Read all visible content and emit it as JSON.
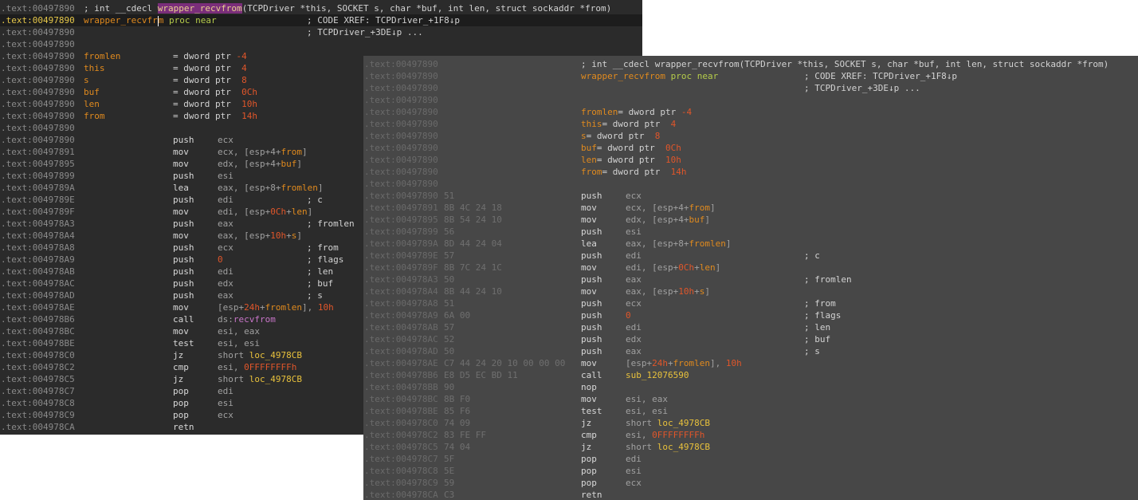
{
  "colors": {
    "left_bg": "#2b2b2b",
    "right_bg": "#474747",
    "comment": "#d3d3d3",
    "highlight_bg": "#7a2e7a",
    "symbol": "#e08a1e",
    "keyword": "#b5cc4a",
    "immediate": "#e0562a",
    "location": "#e8c13c",
    "import": "#c875c8"
  },
  "left_listing": {
    "header_comment_prefix": "; int __cdecl ",
    "header_function_name": "wrapper_recvfrom",
    "header_comment_suffix": "(TCPDriver *this, SOCKET s, char *buf, int len, struct sockaddr *from)",
    "proc_name_before_caret": "wrapper_recvfr",
    "proc_name_after_caret": "m",
    "proc_keyword": "proc near",
    "xref_1": "; CODE XREF: TCPDriver_+1F8↓p",
    "xref_2": "; TCPDriver_+3DE↓p ...",
    "addresses": [
      ".text:00497890",
      ".text:00497890",
      ".text:00497890",
      ".text:00497890",
      ".text:00497890",
      ".text:00497890",
      ".text:00497890",
      ".text:00497890",
      ".text:00497890",
      ".text:00497890",
      ".text:00497890",
      ".text:00497890",
      ".text:00497891",
      ".text:00497895",
      ".text:00497899",
      ".text:0049789A",
      ".text:0049789E",
      ".text:0049789F",
      ".text:004978A3",
      ".text:004978A4",
      ".text:004978A8",
      ".text:004978A9",
      ".text:004978AB",
      ".text:004978AC",
      ".text:004978AD",
      ".text:004978AE",
      ".text:004978B6",
      ".text:004978BC",
      ".text:004978BE",
      ".text:004978C0",
      ".text:004978C2",
      ".text:004978C5",
      ".text:004978C7",
      ".text:004978C8",
      ".text:004978C9",
      ".text:004978CA"
    ],
    "stack_vars": [
      {
        "name": "fromlen",
        "def": "= dword ptr ",
        "off": "-4"
      },
      {
        "name": "this",
        "def": "= dword ptr ",
        "off": " 4"
      },
      {
        "name": "s",
        "def": "= dword ptr ",
        "off": " 8"
      },
      {
        "name": "buf",
        "def": "= dword ptr ",
        "off": " 0Ch"
      },
      {
        "name": "len",
        "def": "= dword ptr ",
        "off": " 10h"
      },
      {
        "name": "from",
        "def": "= dword ptr ",
        "off": " 14h"
      }
    ],
    "instructions": [
      {
        "mnem": "push",
        "ops": [
          [
            "reg",
            "ecx"
          ]
        ],
        "cmt": ""
      },
      {
        "mnem": "mov",
        "ops": [
          [
            "reg",
            "ecx, [esp+4+"
          ],
          [
            "sym",
            "from"
          ],
          [
            "reg",
            "]"
          ]
        ],
        "cmt": ""
      },
      {
        "mnem": "mov",
        "ops": [
          [
            "reg",
            "edx, [esp+4+"
          ],
          [
            "sym",
            "buf"
          ],
          [
            "reg",
            "]"
          ]
        ],
        "cmt": ""
      },
      {
        "mnem": "push",
        "ops": [
          [
            "reg",
            "esi"
          ]
        ],
        "cmt": ""
      },
      {
        "mnem": "lea",
        "ops": [
          [
            "reg",
            "eax, [esp+8+"
          ],
          [
            "sym",
            "fromlen"
          ],
          [
            "reg",
            "]"
          ]
        ],
        "cmt": ""
      },
      {
        "mnem": "push",
        "ops": [
          [
            "reg",
            "edi"
          ]
        ],
        "cmt": "; c"
      },
      {
        "mnem": "mov",
        "ops": [
          [
            "reg",
            "edi, [esp+"
          ],
          [
            "num",
            "0Ch"
          ],
          [
            "reg",
            "+"
          ],
          [
            "sym",
            "len"
          ],
          [
            "reg",
            "]"
          ]
        ],
        "cmt": ""
      },
      {
        "mnem": "push",
        "ops": [
          [
            "reg",
            "eax"
          ]
        ],
        "cmt": "; fromlen"
      },
      {
        "mnem": "mov",
        "ops": [
          [
            "reg",
            "eax, [esp+"
          ],
          [
            "num",
            "10h"
          ],
          [
            "reg",
            "+"
          ],
          [
            "sym",
            "s"
          ],
          [
            "reg",
            "]"
          ]
        ],
        "cmt": ""
      },
      {
        "mnem": "push",
        "ops": [
          [
            "reg",
            "ecx"
          ]
        ],
        "cmt": "; from"
      },
      {
        "mnem": "push",
        "ops": [
          [
            "num",
            "0"
          ]
        ],
        "cmt": "; flags"
      },
      {
        "mnem": "push",
        "ops": [
          [
            "reg",
            "edi"
          ]
        ],
        "cmt": "; len"
      },
      {
        "mnem": "push",
        "ops": [
          [
            "reg",
            "edx"
          ]
        ],
        "cmt": "; buf"
      },
      {
        "mnem": "push",
        "ops": [
          [
            "reg",
            "eax"
          ]
        ],
        "cmt": "; s"
      },
      {
        "mnem": "mov",
        "ops": [
          [
            "reg",
            "[esp+"
          ],
          [
            "num",
            "24h"
          ],
          [
            "reg",
            "+"
          ],
          [
            "sym",
            "fromlen"
          ],
          [
            "reg",
            "], "
          ],
          [
            "num",
            "10h"
          ]
        ],
        "cmt": ""
      },
      {
        "mnem": "call",
        "ops": [
          [
            "reg",
            "ds:"
          ],
          [
            "imp",
            "recvfrom"
          ]
        ],
        "cmt": ""
      },
      {
        "mnem": "mov",
        "ops": [
          [
            "reg",
            "esi, eax"
          ]
        ],
        "cmt": ""
      },
      {
        "mnem": "test",
        "ops": [
          [
            "reg",
            "esi, esi"
          ]
        ],
        "cmt": ""
      },
      {
        "mnem": "jz",
        "ops": [
          [
            "reg",
            "short "
          ],
          [
            "loc",
            "loc_4978CB"
          ]
        ],
        "cmt": ""
      },
      {
        "mnem": "cmp",
        "ops": [
          [
            "reg",
            "esi, "
          ],
          [
            "num",
            "0FFFFFFFFh"
          ]
        ],
        "cmt": ""
      },
      {
        "mnem": "jz",
        "ops": [
          [
            "reg",
            "short "
          ],
          [
            "loc",
            "loc_4978CB"
          ]
        ],
        "cmt": ""
      },
      {
        "mnem": "pop",
        "ops": [
          [
            "reg",
            "edi"
          ]
        ],
        "cmt": ""
      },
      {
        "mnem": "pop",
        "ops": [
          [
            "reg",
            "esi"
          ]
        ],
        "cmt": ""
      },
      {
        "mnem": "pop",
        "ops": [
          [
            "reg",
            "ecx"
          ]
        ],
        "cmt": ""
      },
      {
        "mnem": "retn",
        "ops": [],
        "cmt": ""
      }
    ]
  },
  "right_listing": {
    "header_comment": "; int __cdecl wrapper_recvfrom(TCPDriver *this, SOCKET s, char *buf, int len, struct sockaddr *from)",
    "proc_name": "wrapper_recvfrom",
    "proc_keyword": "proc near",
    "xref_1": "; CODE XREF: TCPDriver_+1F8↓p",
    "xref_2": "; TCPDriver_+3DE↓p ...",
    "addresses": [
      ".text:00497890",
      ".text:00497890",
      ".text:00497890",
      ".text:00497890",
      ".text:00497890",
      ".text:00497890",
      ".text:00497890",
      ".text:00497890",
      ".text:00497890",
      ".text:00497890",
      ".text:00497890",
      ".text:00497890",
      ".text:00497891",
      ".text:00497895",
      ".text:00497899",
      ".text:0049789A",
      ".text:0049789E",
      ".text:0049789F",
      ".text:004978A3",
      ".text:004978A4",
      ".text:004978A8",
      ".text:004978A9",
      ".text:004978AB",
      ".text:004978AC",
      ".text:004978AD",
      ".text:004978AE",
      ".text:004978B6",
      ".text:004978BB",
      ".text:004978BC",
      ".text:004978BE",
      ".text:004978C0",
      ".text:004978C2",
      ".text:004978C5",
      ".text:004978C7",
      ".text:004978C8",
      ".text:004978C9",
      ".text:004978CA"
    ],
    "stack_vars": [
      {
        "name": "fromlen",
        "def": "= dword ptr ",
        "off": "-4"
      },
      {
        "name": "this",
        "def": "= dword ptr  ",
        "off": "4"
      },
      {
        "name": "s",
        "def": "= dword ptr  ",
        "off": "8"
      },
      {
        "name": "buf",
        "def": "= dword ptr  ",
        "off": "0Ch"
      },
      {
        "name": "len",
        "def": "= dword ptr  ",
        "off": "10h"
      },
      {
        "name": "from",
        "def": "= dword ptr  ",
        "off": "14h"
      }
    ],
    "instructions": [
      {
        "bytes": "51",
        "mnem": "push",
        "ops": [
          [
            "reg",
            "ecx"
          ]
        ],
        "cmt": ""
      },
      {
        "bytes": "8B 4C 24 18",
        "mnem": "mov",
        "ops": [
          [
            "reg",
            "ecx, [esp+4+"
          ],
          [
            "sym",
            "from"
          ],
          [
            "reg",
            "]"
          ]
        ],
        "cmt": ""
      },
      {
        "bytes": "8B 54 24 10",
        "mnem": "mov",
        "ops": [
          [
            "reg",
            "edx, [esp+4+"
          ],
          [
            "sym",
            "buf"
          ],
          [
            "reg",
            "]"
          ]
        ],
        "cmt": ""
      },
      {
        "bytes": "56",
        "mnem": "push",
        "ops": [
          [
            "reg",
            "esi"
          ]
        ],
        "cmt": ""
      },
      {
        "bytes": "8D 44 24 04",
        "mnem": "lea",
        "ops": [
          [
            "reg",
            "eax, [esp+8+"
          ],
          [
            "sym",
            "fromlen"
          ],
          [
            "reg",
            "]"
          ]
        ],
        "cmt": ""
      },
      {
        "bytes": "57",
        "mnem": "push",
        "ops": [
          [
            "reg",
            "edi"
          ]
        ],
        "cmt": "; c"
      },
      {
        "bytes": "8B 7C 24 1C",
        "mnem": "mov",
        "ops": [
          [
            "reg",
            "edi, [esp+"
          ],
          [
            "num",
            "0Ch"
          ],
          [
            "reg",
            "+"
          ],
          [
            "sym",
            "len"
          ],
          [
            "reg",
            "]"
          ]
        ],
        "cmt": ""
      },
      {
        "bytes": "50",
        "mnem": "push",
        "ops": [
          [
            "reg",
            "eax"
          ]
        ],
        "cmt": "; fromlen"
      },
      {
        "bytes": "8B 44 24 10",
        "mnem": "mov",
        "ops": [
          [
            "reg",
            "eax, [esp+"
          ],
          [
            "num",
            "10h"
          ],
          [
            "reg",
            "+"
          ],
          [
            "sym",
            "s"
          ],
          [
            "reg",
            "]"
          ]
        ],
        "cmt": ""
      },
      {
        "bytes": "51",
        "mnem": "push",
        "ops": [
          [
            "reg",
            "ecx"
          ]
        ],
        "cmt": "; from"
      },
      {
        "bytes": "6A 00",
        "mnem": "push",
        "ops": [
          [
            "num",
            "0"
          ]
        ],
        "cmt": "; flags"
      },
      {
        "bytes": "57",
        "mnem": "push",
        "ops": [
          [
            "reg",
            "edi"
          ]
        ],
        "cmt": "; len"
      },
      {
        "bytes": "52",
        "mnem": "push",
        "ops": [
          [
            "reg",
            "edx"
          ]
        ],
        "cmt": "; buf"
      },
      {
        "bytes": "50",
        "mnem": "push",
        "ops": [
          [
            "reg",
            "eax"
          ]
        ],
        "cmt": "; s"
      },
      {
        "bytes": "C7 44 24 20 10 00 00 00",
        "mnem": "mov",
        "ops": [
          [
            "reg",
            "[esp+"
          ],
          [
            "num",
            "24h"
          ],
          [
            "reg",
            "+"
          ],
          [
            "sym",
            "fromlen"
          ],
          [
            "reg",
            "], "
          ],
          [
            "num",
            "10h"
          ]
        ],
        "cmt": ""
      },
      {
        "bytes": "E8 D5 EC BD 11",
        "mnem": "call",
        "ops": [
          [
            "sub",
            "sub_12076590"
          ]
        ],
        "cmt": ""
      },
      {
        "bytes": "90",
        "mnem": "nop",
        "ops": [],
        "cmt": ""
      },
      {
        "bytes": "8B F0",
        "mnem": "mov",
        "ops": [
          [
            "reg",
            "esi, eax"
          ]
        ],
        "cmt": ""
      },
      {
        "bytes": "85 F6",
        "mnem": "test",
        "ops": [
          [
            "reg",
            "esi, esi"
          ]
        ],
        "cmt": ""
      },
      {
        "bytes": "74 09",
        "mnem": "jz",
        "ops": [
          [
            "reg",
            "short "
          ],
          [
            "loc",
            "loc_4978CB"
          ]
        ],
        "cmt": ""
      },
      {
        "bytes": "83 FE FF",
        "mnem": "cmp",
        "ops": [
          [
            "reg",
            "esi, "
          ],
          [
            "num",
            "0FFFFFFFFh"
          ]
        ],
        "cmt": ""
      },
      {
        "bytes": "74 04",
        "mnem": "jz",
        "ops": [
          [
            "reg",
            "short "
          ],
          [
            "loc",
            "loc_4978CB"
          ]
        ],
        "cmt": ""
      },
      {
        "bytes": "5F",
        "mnem": "pop",
        "ops": [
          [
            "reg",
            "edi"
          ]
        ],
        "cmt": ""
      },
      {
        "bytes": "5E",
        "mnem": "pop",
        "ops": [
          [
            "reg",
            "esi"
          ]
        ],
        "cmt": ""
      },
      {
        "bytes": "59",
        "mnem": "pop",
        "ops": [
          [
            "reg",
            "ecx"
          ]
        ],
        "cmt": ""
      },
      {
        "bytes": "C3",
        "mnem": "retn",
        "ops": [],
        "cmt": ""
      }
    ]
  }
}
